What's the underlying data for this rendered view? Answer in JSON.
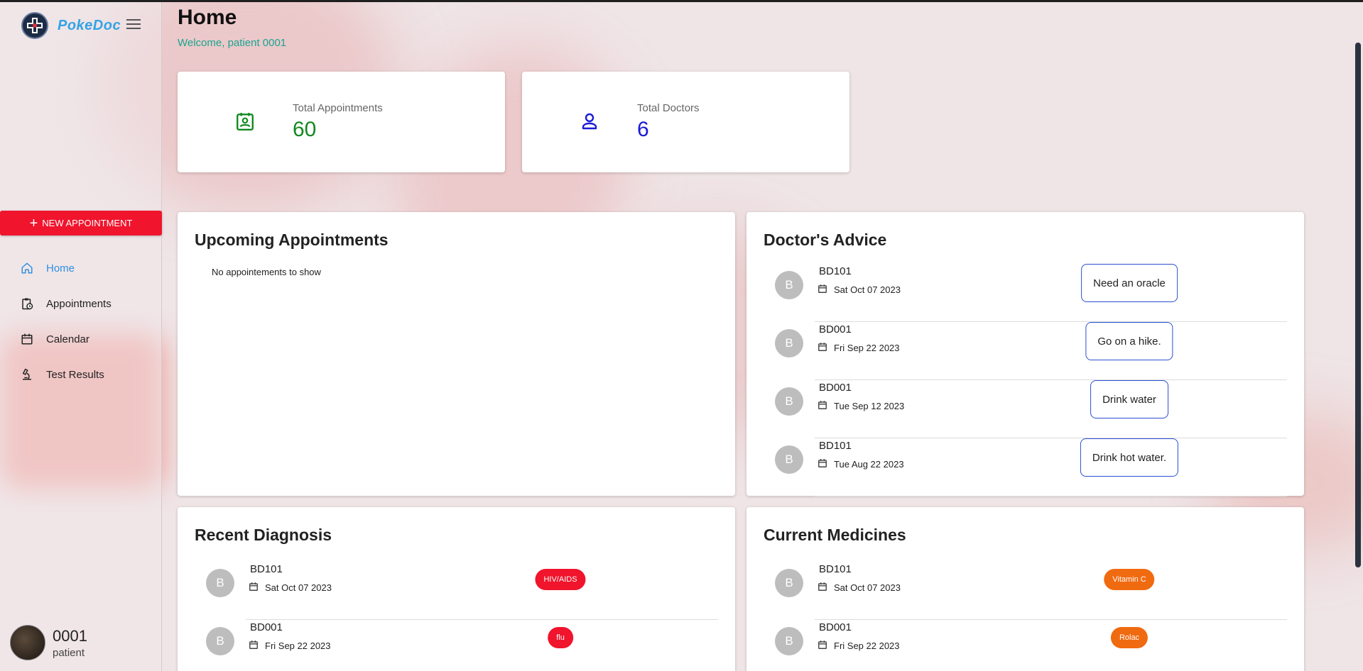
{
  "app": {
    "brand": "PokeDoc"
  },
  "sidebar": {
    "new_appointment_label": "NEW APPOINTMENT",
    "items": [
      {
        "label": "Home",
        "icon": "home-icon",
        "active": true
      },
      {
        "label": "Appointments",
        "icon": "clipboard-clock-icon",
        "active": false
      },
      {
        "label": "Calendar",
        "icon": "calendar-icon",
        "active": false
      },
      {
        "label": "Test Results",
        "icon": "microscope-icon",
        "active": false
      }
    ],
    "user": {
      "id": "0001",
      "role": "patient"
    }
  },
  "header": {
    "title": "Home",
    "welcome": "Welcome, patient 0001"
  },
  "stats": [
    {
      "label": "Total Appointments",
      "value": "60",
      "color": "#12891f",
      "icon": "contact-card-icon"
    },
    {
      "label": "Total Doctors",
      "value": "6",
      "color": "#1a1ad6",
      "icon": "person-icon"
    }
  ],
  "upcoming": {
    "title": "Upcoming Appointments",
    "empty": "No appointements to show"
  },
  "advice": {
    "title": "Doctor's Advice",
    "items": [
      {
        "initial": "B",
        "doctor": "BD101",
        "date": "Sat Oct 07 2023",
        "text": "Need an oracle"
      },
      {
        "initial": "B",
        "doctor": "BD001",
        "date": "Fri Sep 22 2023",
        "text": "Go on a hike."
      },
      {
        "initial": "B",
        "doctor": "BD001",
        "date": "Tue Sep 12 2023",
        "text": "Drink water"
      },
      {
        "initial": "B",
        "doctor": "BD101",
        "date": "Tue Aug 22 2023",
        "text": "Drink hot water."
      }
    ]
  },
  "diagnosis": {
    "title": "Recent Diagnosis",
    "items": [
      {
        "initial": "B",
        "doctor": "BD101",
        "date": "Sat Oct 07 2023",
        "tag": "HIV/AIDS"
      },
      {
        "initial": "B",
        "doctor": "BD001",
        "date": "Fri Sep 22 2023",
        "tag": "flu"
      }
    ]
  },
  "medicines": {
    "title": "Current Medicines",
    "items": [
      {
        "initial": "B",
        "doctor": "BD101",
        "date": "Sat Oct 07 2023",
        "tag": "Vitamin C"
      },
      {
        "initial": "B",
        "doctor": "BD001",
        "date": "Fri Sep 22 2023",
        "tag": "Rolac"
      }
    ]
  }
}
